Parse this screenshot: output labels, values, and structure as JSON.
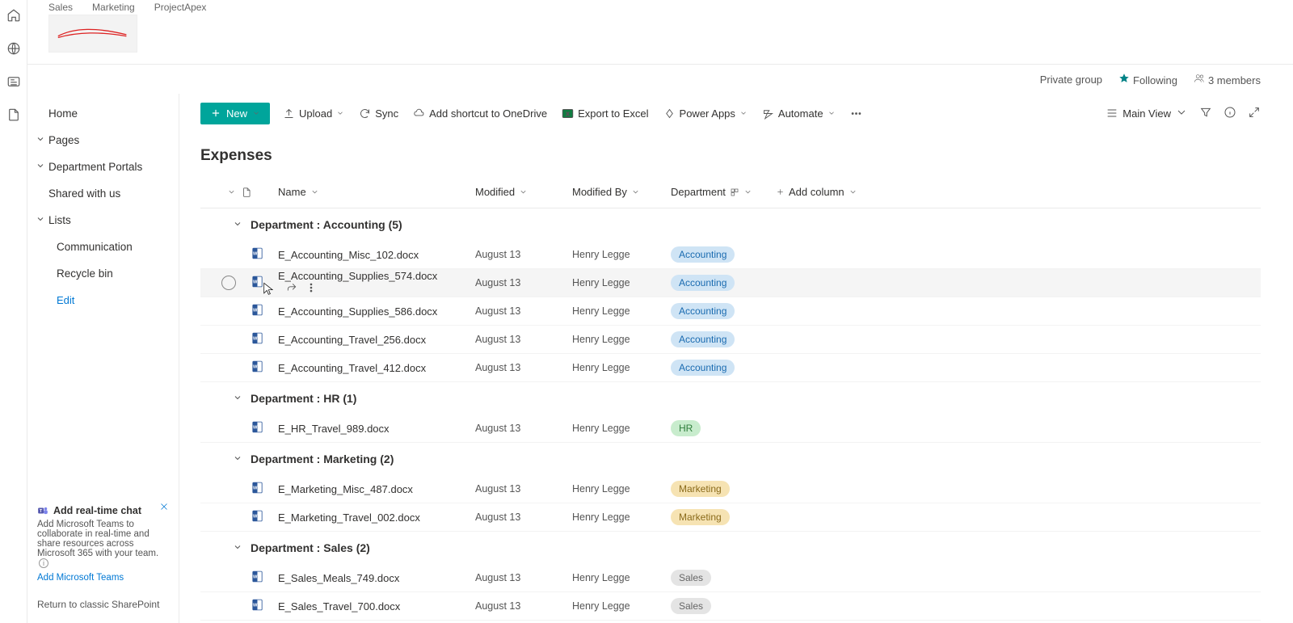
{
  "rail": {
    "items": [
      "home",
      "globe",
      "contacts",
      "files"
    ]
  },
  "headerTabs": [
    "Sales",
    "Marketing",
    "ProjectApex"
  ],
  "groupInfo": {
    "privacy": "Private group",
    "following": "Following",
    "members": "3 members"
  },
  "leftNav": {
    "home": "Home",
    "pages": "Pages",
    "portals": "Department Portals",
    "shared": "Shared with us",
    "lists": "Lists",
    "communication": "Communication",
    "recycle": "Recycle bin",
    "edit": "Edit"
  },
  "promo": {
    "title": "Add real-time chat",
    "body": "Add Microsoft Teams to collaborate in real-time and share resources across Microsoft 365 with your team.",
    "addLink": "Add Microsoft Teams"
  },
  "classicLink": "Return to classic SharePoint",
  "toolbar": {
    "new": "New",
    "upload": "Upload",
    "sync": "Sync",
    "shortcut": "Add shortcut to OneDrive",
    "excel": "Export to Excel",
    "powerapps": "Power Apps",
    "automate": "Automate",
    "view": "Main View"
  },
  "pageTitle": "Expenses",
  "columns": {
    "name": "Name",
    "modified": "Modified",
    "modifiedBy": "Modified By",
    "department": "Department",
    "addColumn": "Add column"
  },
  "groups": [
    {
      "label": "Department : Accounting (5)",
      "tagClass": "accounting",
      "tagText": "Accounting",
      "rows": [
        {
          "name": "E_Accounting_Misc_102.docx",
          "modified": "August 13",
          "by": "Henry Legge",
          "hovered": false
        },
        {
          "name": "E_Accounting_Supplies_574.docx",
          "modified": "August 13",
          "by": "Henry Legge",
          "hovered": true
        },
        {
          "name": "E_Accounting_Supplies_586.docx",
          "modified": "August 13",
          "by": "Henry Legge",
          "hovered": false
        },
        {
          "name": "E_Accounting_Travel_256.docx",
          "modified": "August 13",
          "by": "Henry Legge",
          "hovered": false
        },
        {
          "name": "E_Accounting_Travel_412.docx",
          "modified": "August 13",
          "by": "Henry Legge",
          "hovered": false
        }
      ]
    },
    {
      "label": "Department : HR (1)",
      "tagClass": "hr",
      "tagText": "HR",
      "rows": [
        {
          "name": "E_HR_Travel_989.docx",
          "modified": "August 13",
          "by": "Henry Legge",
          "hovered": false
        }
      ]
    },
    {
      "label": "Department : Marketing (2)",
      "tagClass": "marketing",
      "tagText": "Marketing",
      "rows": [
        {
          "name": "E_Marketing_Misc_487.docx",
          "modified": "August 13",
          "by": "Henry Legge",
          "hovered": false
        },
        {
          "name": "E_Marketing_Travel_002.docx",
          "modified": "August 13",
          "by": "Henry Legge",
          "hovered": false
        }
      ]
    },
    {
      "label": "Department : Sales (2)",
      "tagClass": "sales",
      "tagText": "Sales",
      "rows": [
        {
          "name": "E_Sales_Meals_749.docx",
          "modified": "August 13",
          "by": "Henry Legge",
          "hovered": false
        },
        {
          "name": "E_Sales_Travel_700.docx",
          "modified": "August 13",
          "by": "Henry Legge",
          "hovered": false
        }
      ]
    }
  ]
}
